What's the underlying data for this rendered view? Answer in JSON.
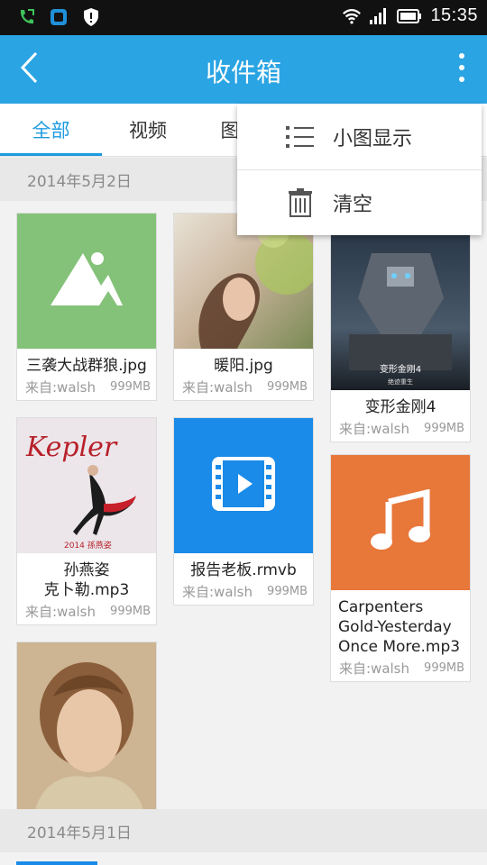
{
  "status_bar": {
    "time": "15:35"
  },
  "app_bar": {
    "title": "收件箱"
  },
  "tabs": [
    {
      "label": "全部"
    },
    {
      "label": "视频"
    },
    {
      "label": "图"
    }
  ],
  "sections": [
    {
      "date": "2014年5月2日"
    },
    {
      "date": "2014年5月1日"
    }
  ],
  "files": [
    {
      "name": "三袭大战群狼.jpg",
      "from": "来自:walsh",
      "size": "999MB",
      "type": "image-placeholder",
      "color": "#84c27a"
    },
    {
      "name": "暖阳.jpg",
      "from": "来自:walsh",
      "size": "999MB",
      "type": "photo"
    },
    {
      "name": "变形金刚4",
      "from": "来自:walsh",
      "size": "999MB",
      "type": "poster"
    },
    {
      "name": "孙燕姿\n克卜勒.mp3",
      "from": "来自:walsh",
      "size": "999MB",
      "type": "album"
    },
    {
      "name": "报告老板.rmvb",
      "from": "来自:walsh",
      "size": "999MB",
      "type": "video",
      "color": "#1a8be8"
    },
    {
      "name": "Carpenters Gold-Yesterday Once More.mp3",
      "from": "来自:walsh",
      "size": "999MB",
      "type": "music",
      "color": "#e8773a"
    },
    {
      "name": "",
      "from": "",
      "size": "",
      "type": "portrait"
    }
  ],
  "menu": {
    "items": [
      {
        "label": "小图显示",
        "icon": "list-icon"
      },
      {
        "label": "清空",
        "icon": "trash-icon"
      }
    ]
  },
  "colors": {
    "accent": "#2aa4e3",
    "tab_active": "#1e9be0"
  }
}
